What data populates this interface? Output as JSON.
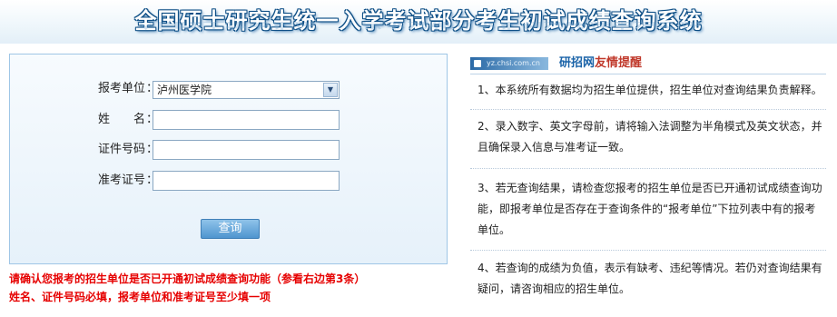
{
  "header": {
    "title": "全国硕士研究生统一入学考试部分考生初试成绩查询系统"
  },
  "form": {
    "unit_label": "报考单位",
    "unit_value": "泸州医学院",
    "name_label": "姓　　名",
    "id_label": "证件号码",
    "ticket_label": "准考证号",
    "colon": "：",
    "submit_label": "查询"
  },
  "notes": [
    "请确认您报考的招生单位是否已开通初试成绩查询功能（参看右边第3条）",
    "姓名、证件号码必填，报考单位和准考证号至少填一项"
  ],
  "tips": {
    "badge": "yz.chsi.com.cn",
    "title_a": "研招网",
    "title_b": "友情提醒",
    "items": [
      "1、本系统所有数据均为招生单位提供，招生单位对查询结果负责解释。",
      "2、录入数字、英文字母前，请将输入法调整为半角模式及英文状态，并且确保录入信息与准考证一致。",
      "3、若无查询结果，请检查您报考的招生单位是否已开通初试成绩查询功能，即报考单位是否存在于查询条件的“报考单位”下拉列表中有的报考单位。",
      "4、若查询的成绩为负值，表示有缺考、违纪等情况。若仍对查询结果有疑问，请咨询相应的招生单位。"
    ]
  },
  "colors": {
    "title_outline": "#0e4f86",
    "panel_border": "#9fc6e6",
    "button": "#4f95cf",
    "notes": "#e60000",
    "tips_title_blue": "#1a63a8",
    "tips_title_red": "#c0392b"
  },
  "icons": {
    "select_arrow": "chevron-down-icon",
    "badge_icon": "site-icon"
  }
}
